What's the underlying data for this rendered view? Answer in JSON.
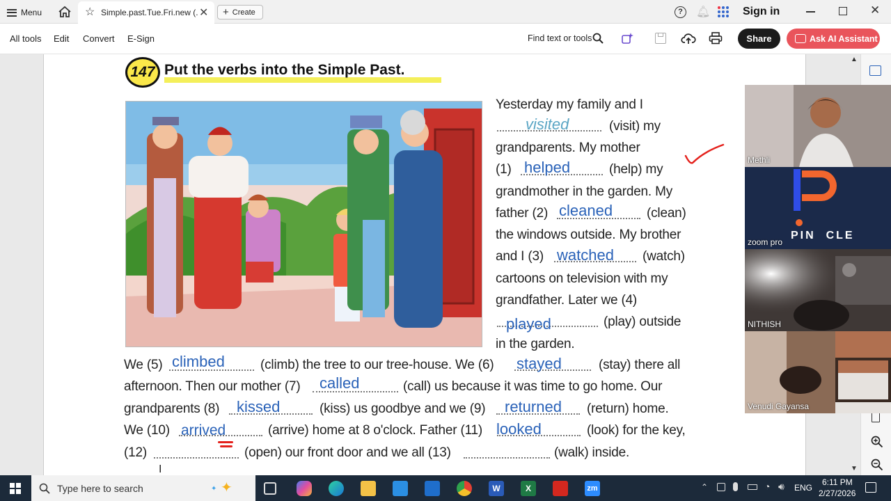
{
  "tabbar": {
    "menu_label": "Menu",
    "tab_title": "Simple.past.Tue.Fri.new (...",
    "create_label": "Create",
    "sign_in_label": "Sign in"
  },
  "toolbar": {
    "all_tools": "All tools",
    "edit": "Edit",
    "convert": "Convert",
    "esign": "E-Sign",
    "find_label": "Find text or tools",
    "share_label": "Share",
    "ai_label": "Ask AI Assistant"
  },
  "exercise": {
    "number": "147",
    "title": "Put the verbs into the Simple Past.",
    "right_lines": [
      "Yesterday my family and I",
      "(visit) my",
      "grandparents. My mother",
      "(1)",
      "(help) my",
      "grandmother in the garden. My",
      "father (2)",
      "(clean)",
      "the windows outside. My brother",
      "and I (3)",
      "(watch)",
      "cartoons on television with my",
      "grandfather. Later we (4)",
      "(play) outside",
      "in the garden."
    ],
    "bottom_lines": [
      "We (5)",
      "(climb) the tree to our tree-house. We (6)",
      "(stay) there all",
      "afternoon. Then our mother (7)",
      "(call) us because it was time to go home. Our",
      "grandparents (8)",
      "(kiss) us goodbye and we (9)",
      "(return) home.",
      "We (10)",
      "(arrive) home at 8 o'clock. Father (11)",
      "(look) for the key,",
      "(12)",
      "(open) our front door and we all (13)",
      "(walk) inside."
    ],
    "answers": {
      "example": "visited",
      "a1": "helped",
      "a2": "cleaned",
      "a3": "watched",
      "a4": "played",
      "a5": "climbed",
      "a6": "stayed",
      "a7": "called",
      "a8": "kissed",
      "a9": "returned",
      "a10": "arrived",
      "a11": "looked"
    }
  },
  "participants": [
    {
      "name": "Methli"
    },
    {
      "name": "zoom pro",
      "logo_text": "PIN  CLE"
    },
    {
      "name": "NITHISH"
    },
    {
      "name": "Venudi Gayansa"
    }
  ],
  "taskbar": {
    "search_placeholder": "Type here to search",
    "lang": "ENG",
    "time": "6:11 PM",
    "date": "2/27/2026"
  },
  "colors": {
    "accent_red": "#e9545b",
    "answer_blue": "#2a62b8",
    "share_bg": "#1b1b1b"
  }
}
